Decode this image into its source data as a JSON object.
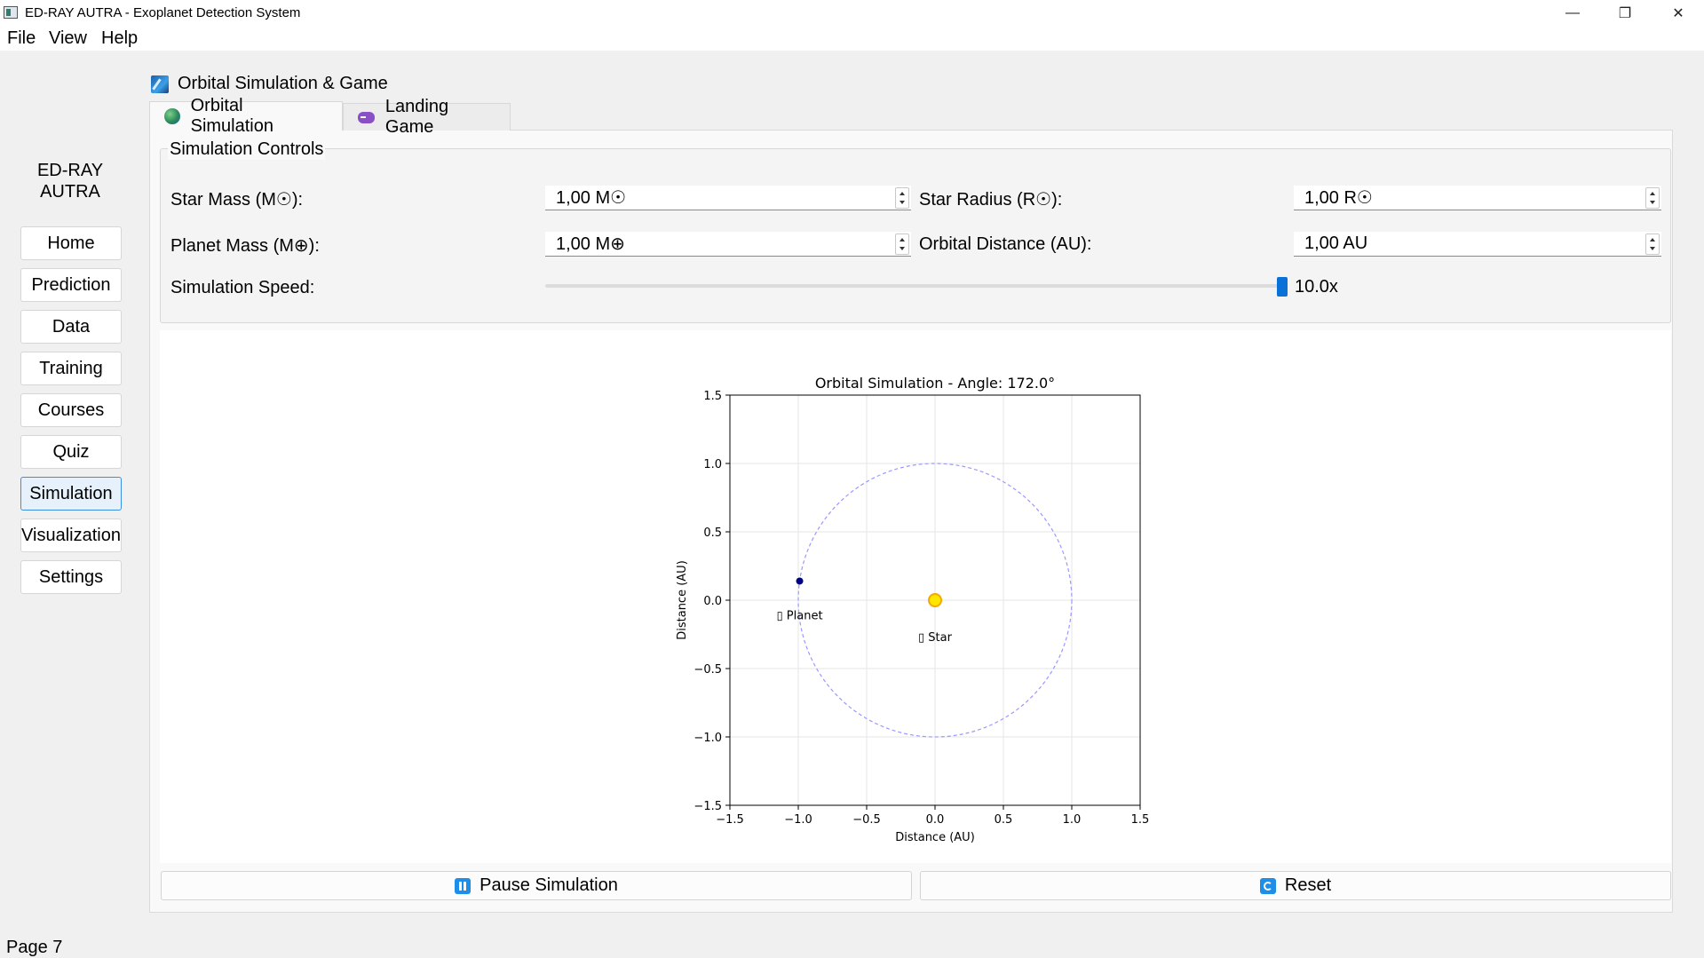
{
  "window": {
    "title": "ED-RAY AUTRA - Exoplanet Detection System",
    "controls": {
      "minimize": "—",
      "restore": "❐",
      "close": "✕"
    }
  },
  "menu": [
    "File",
    "View",
    "Help"
  ],
  "sidebar": {
    "brand_line1": "ED-RAY",
    "brand_line2": "AUTRA",
    "items": [
      {
        "label": "Home"
      },
      {
        "label": "Prediction"
      },
      {
        "label": "Data"
      },
      {
        "label": "Training"
      },
      {
        "label": "Courses"
      },
      {
        "label": "Quiz"
      },
      {
        "label": "Simulation",
        "active": true
      },
      {
        "label": "Visualization"
      },
      {
        "label": "Settings"
      }
    ]
  },
  "content": {
    "title": "Orbital Simulation & Game",
    "title_icon": "comet-icon",
    "tabs": [
      {
        "label": "Orbital Simulation",
        "icon": "globe-icon",
        "active": true
      },
      {
        "label": "Landing Game",
        "icon": "gamepad-icon",
        "active": false
      }
    ]
  },
  "controls": {
    "group_title": "Simulation Controls",
    "star_mass_label": "Star Mass (M☉):",
    "star_mass_value": "1,00 M☉",
    "star_radius_label": "Star Radius (R☉):",
    "star_radius_value": "1,00 R☉",
    "planet_mass_label": "Planet Mass (M⊕):",
    "planet_mass_value": "1,00 M⊕",
    "orbital_distance_label": "Orbital Distance (AU):",
    "orbital_distance_value": "1,00 AU",
    "speed_label": "Simulation Speed:",
    "speed_value": "10.0x",
    "speed_level": 1.0
  },
  "chart_data": {
    "type": "scatter",
    "title": "Orbital Simulation - Angle: 172.0°",
    "xlabel": "Distance (AU)",
    "ylabel": "Distance (AU)",
    "xlim": [
      -1.5,
      1.5
    ],
    "ylim": [
      -1.5,
      1.5
    ],
    "xticks": [
      "−1.5",
      "−1.0",
      "−0.5",
      "0.0",
      "0.5",
      "1.0",
      "1.5"
    ],
    "yticks": [
      "1.5",
      "1.0",
      "0.5",
      "0.0",
      "−0.5",
      "−1.0",
      "−1.5"
    ],
    "grid": true,
    "orbit": {
      "radius": 1.0,
      "style": "dashed",
      "color": "#9999ff"
    },
    "star": {
      "x": 0.0,
      "y": 0.0,
      "label": "▯ Star",
      "color": "#ffe600",
      "edge": "#f2a900"
    },
    "planet": {
      "x": -0.99,
      "y": 0.14,
      "label": "▯ Planet",
      "color": "#00008b"
    }
  },
  "buttons": {
    "pause_label": "Pause Simulation",
    "reset_label": "Reset"
  },
  "status": "Page 7"
}
